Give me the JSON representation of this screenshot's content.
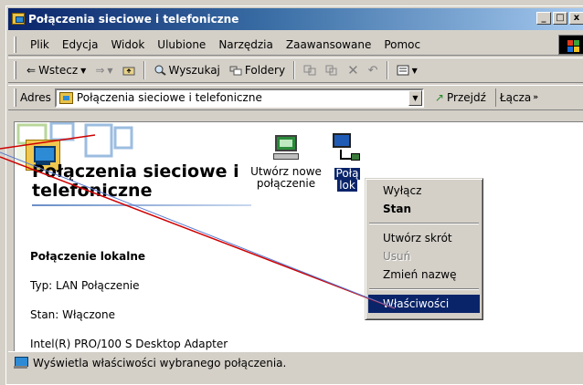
{
  "window": {
    "title": "Połączenia sieciowe i telefoniczne",
    "minimize": "_",
    "maximize": "□",
    "close": "x"
  },
  "menubar": {
    "items": [
      "Plik",
      "Edycja",
      "Widok",
      "Ulubione",
      "Narzędzia",
      "Zaawansowane",
      "Pomoc"
    ]
  },
  "toolbar": {
    "back": "Wstecz",
    "search": "Wyszukaj",
    "folders": "Foldery"
  },
  "addressbar": {
    "label": "Adres",
    "value": "Połączenia sieciowe i telefoniczne",
    "go": "Przejdź",
    "links": "Łącza"
  },
  "left_panel": {
    "title": "Połączenia sieciowe i telefoniczne",
    "connection_name": "Połączenie lokalne",
    "type": "Typ: LAN Połączenie",
    "status": "Stan: Włączone",
    "adapter": "Intel(R) PRO/100 S Desktop Adapter"
  },
  "icons": {
    "new_connection_line1": "Utwórz nowe",
    "new_connection_line2": "połączenie",
    "local_line1": "Połą",
    "local_line2": "lok"
  },
  "context_menu": {
    "disable": "Wyłącz",
    "status": "Stan",
    "create_shortcut": "Utwórz skrót",
    "delete": "Usuń",
    "rename": "Zmień nazwę",
    "properties": "Właściwości"
  },
  "statusbar": {
    "text": "Wyświetla właściwości wybranego połączenia."
  },
  "colors": {
    "title_active": "#0a246a",
    "selection": "#0a246a",
    "annotation_line": "#d00000"
  }
}
